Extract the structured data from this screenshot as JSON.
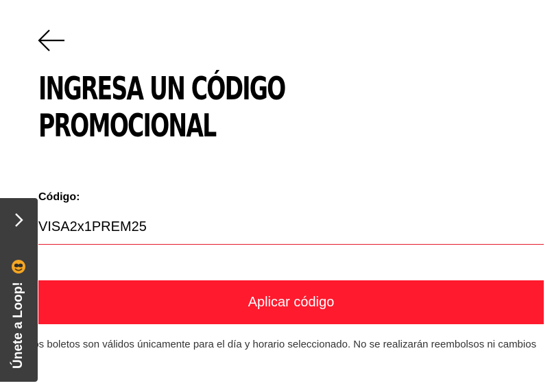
{
  "header": {
    "back_icon": "arrow-left-icon",
    "title_line1": "INGRESA UN CÓDIGO",
    "title_line2": "PROMOCIONAL"
  },
  "form": {
    "code_label": "Código:",
    "code_value": "VISA2x1PREM25",
    "apply_label": "Aplicar código",
    "disclaimer": "Los boletos son válidos únicamente para el día y horario seleccionado. No se realizarán reembolsos ni cambios"
  },
  "loop_tab": {
    "label": "Únete a Loop!",
    "chevron_icon": "chevron-right-icon",
    "emoji_icon": "smiley-emoji-icon"
  },
  "colors": {
    "accent": "#ff1a2e",
    "underline": "#e51a2b",
    "tab_background": "#3d3d3d"
  }
}
